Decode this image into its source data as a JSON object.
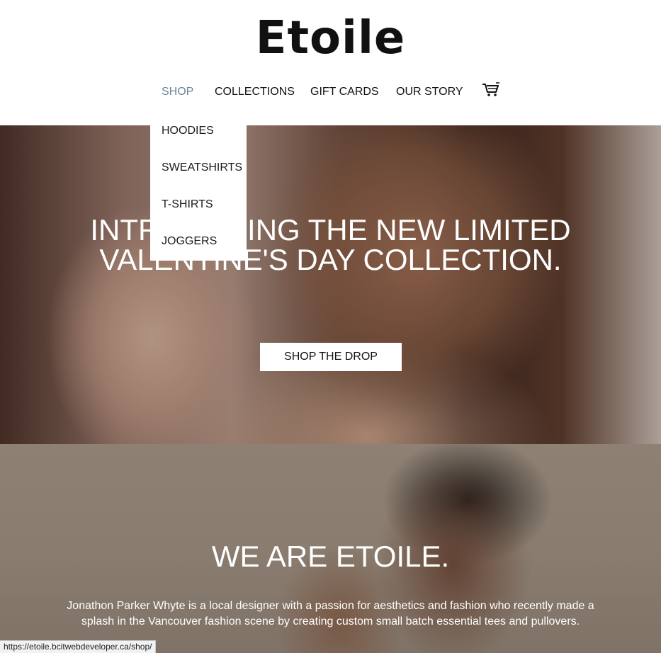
{
  "brand": {
    "logo_text": "Etoile"
  },
  "nav": {
    "items": [
      {
        "label": "SHOP",
        "active": true
      },
      {
        "label": "COLLECTIONS",
        "active": false
      },
      {
        "label": "GIFT CARDS",
        "active": false
      },
      {
        "label": "OUR STORY",
        "active": false
      }
    ],
    "cart_icon": "cart-icon",
    "active_color": "#6b8596"
  },
  "dropdown": {
    "items": [
      {
        "label": "HOODIES"
      },
      {
        "label": "SWEATSHIRTS"
      },
      {
        "label": "T-SHIRTS"
      },
      {
        "label": "JOGGERS"
      }
    ]
  },
  "hero": {
    "title_line1": "INTRODUCING THE NEW LIMITED",
    "title_line2": "VALENTINE'S DAY COLLECTION.",
    "button_label": "SHOP THE DROP"
  },
  "about": {
    "title": "WE ARE ETOILE.",
    "text": "Jonathon Parker Whyte is a local designer with a passion for aesthetics and fashion who recently made a splash in the Vancouver fashion scene by creating custom small batch essential tees and pullovers."
  },
  "status_bar": {
    "url": "https://etoile.bcitwebdeveloper.ca/shop/"
  }
}
